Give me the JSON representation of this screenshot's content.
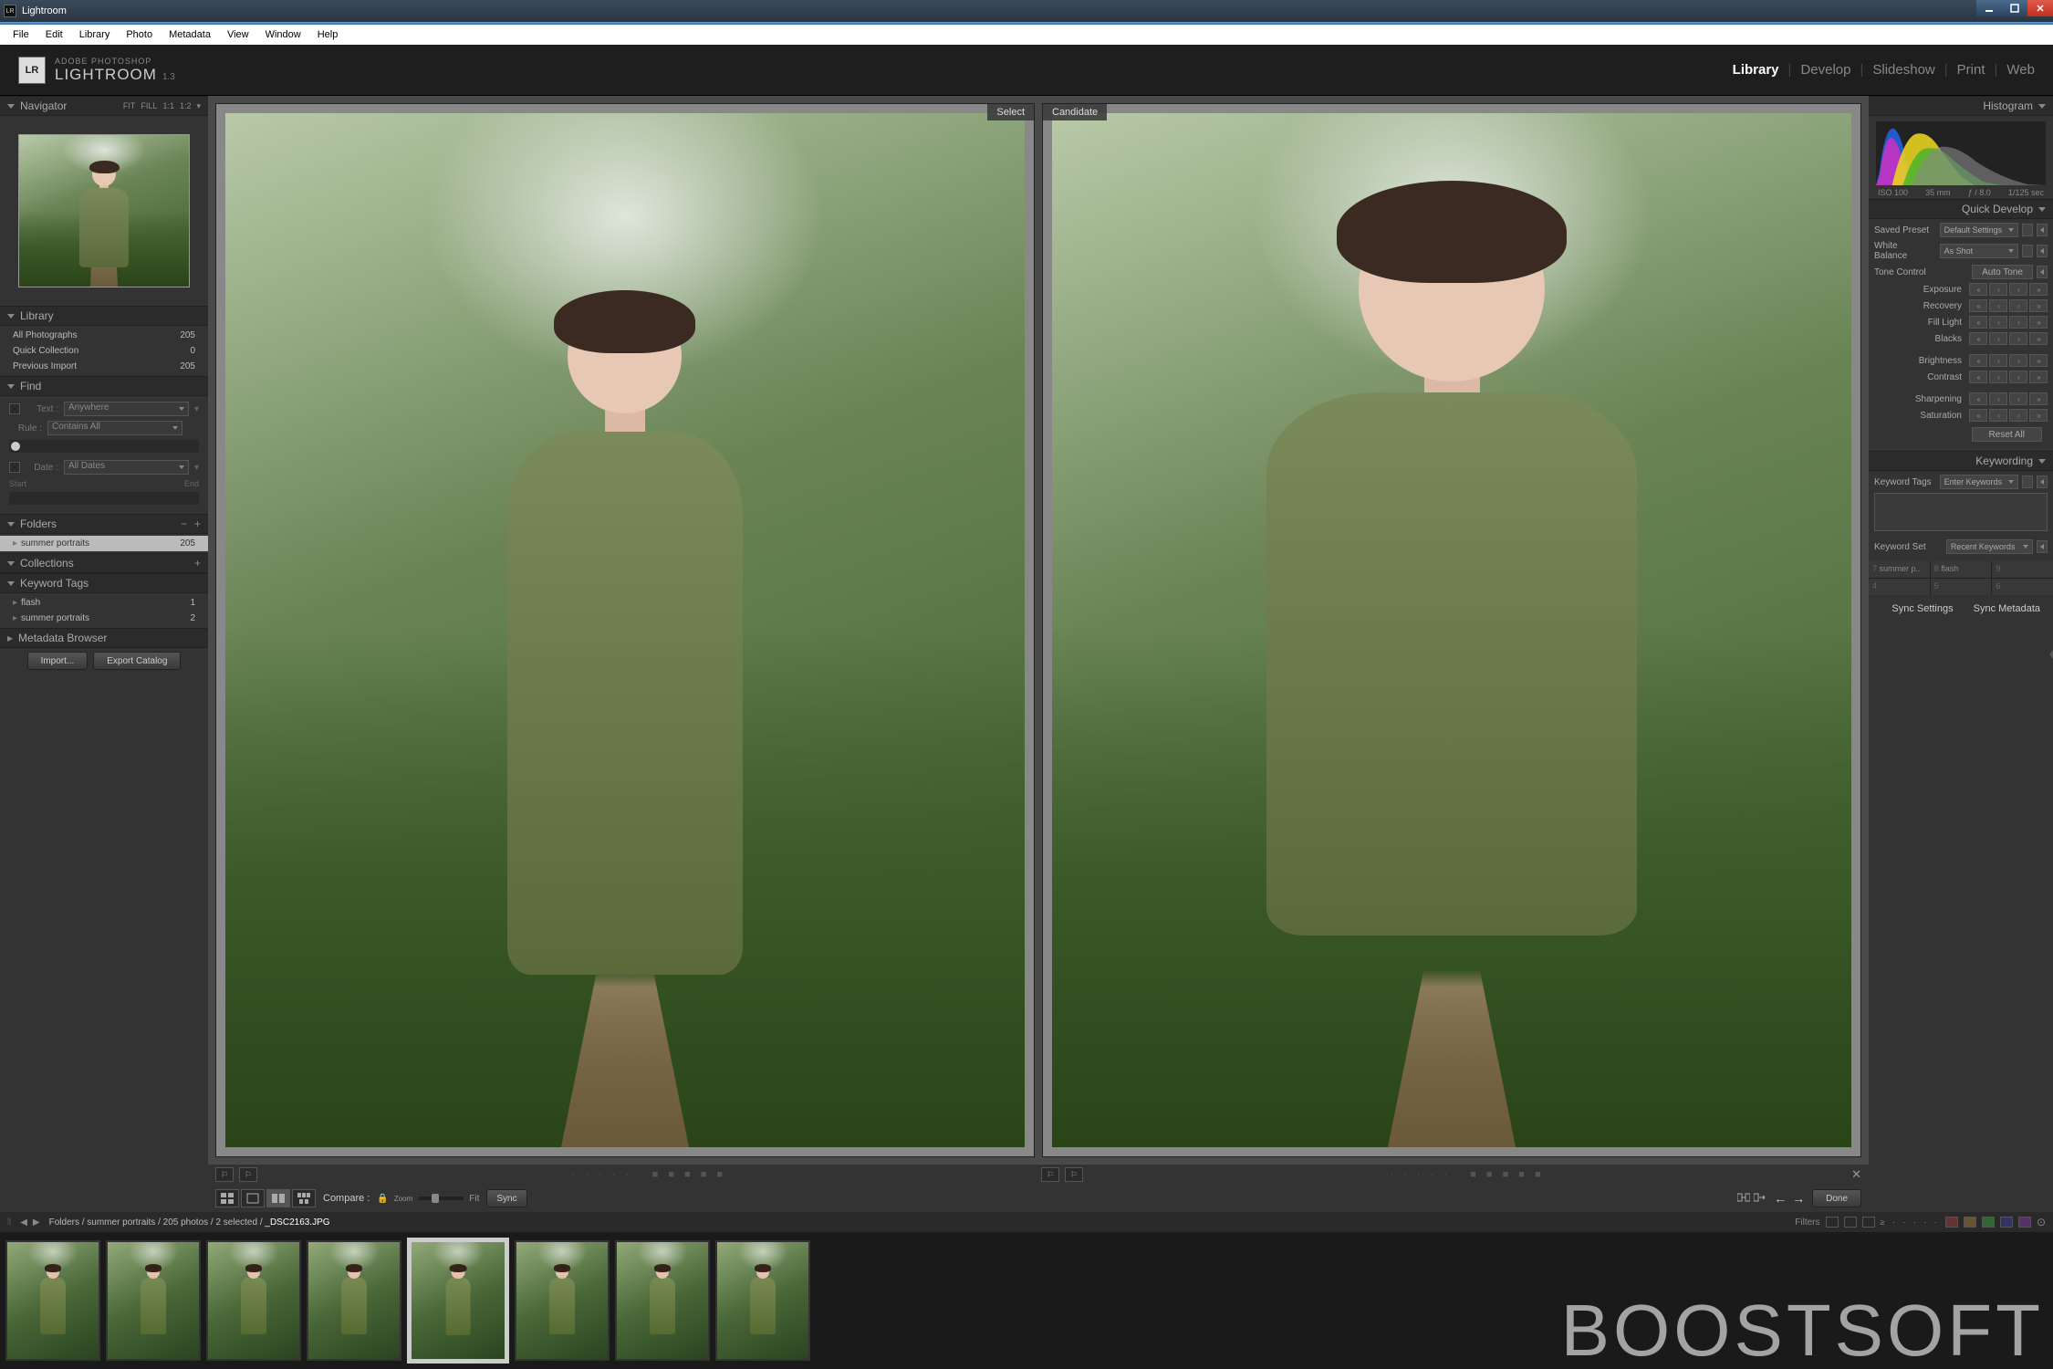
{
  "window": {
    "title": "Lightroom"
  },
  "menubar": [
    "File",
    "Edit",
    "Library",
    "Photo",
    "Metadata",
    "View",
    "Window",
    "Help"
  ],
  "brand": {
    "line1": "ADOBE PHOTOSHOP",
    "line2": "LIGHTROOM",
    "version": "1.3",
    "logo": "LR"
  },
  "modules": [
    {
      "label": "Library",
      "active": true
    },
    {
      "label": "Develop",
      "active": false
    },
    {
      "label": "Slideshow",
      "active": false
    },
    {
      "label": "Print",
      "active": false
    },
    {
      "label": "Web",
      "active": false
    }
  ],
  "navigator": {
    "title": "Navigator",
    "zoom_opts": [
      "FIT",
      "FILL",
      "1:1",
      "1:2"
    ]
  },
  "library": {
    "title": "Library",
    "items": [
      {
        "label": "All Photographs",
        "count": "205"
      },
      {
        "label": "Quick Collection",
        "count": "0"
      },
      {
        "label": "Previous Import",
        "count": "205"
      }
    ]
  },
  "find": {
    "title": "Find",
    "text_label": "Text :",
    "text_value": "Anywhere",
    "rule_label": "Rule :",
    "rule_value": "Contains All",
    "date_label": "Date :",
    "date_value": "All Dates",
    "start": "Start",
    "end": "End"
  },
  "folders": {
    "title": "Folders",
    "items": [
      {
        "label": "summer portraits",
        "count": "205",
        "selected": true
      }
    ]
  },
  "collections": {
    "title": "Collections"
  },
  "keyword_tags": {
    "title": "Keyword Tags",
    "items": [
      {
        "label": "flash",
        "count": "1"
      },
      {
        "label": "summer portraits",
        "count": "2"
      }
    ]
  },
  "metadata_browser": {
    "title": "Metadata Browser"
  },
  "compare": {
    "select_label": "Select",
    "candidate_label": "Candidate"
  },
  "left_toolbar": {
    "import": "Import...",
    "export": "Export Catalog"
  },
  "main_toolbar": {
    "compare_label": "Compare :",
    "zoom": "Zoom",
    "fit": "Fit",
    "sync": "Sync",
    "done": "Done"
  },
  "histogram": {
    "title": "Histogram",
    "iso": "ISO 100",
    "focal": "35 mm",
    "aperture": "ƒ / 8.0",
    "shutter": "1/125 sec"
  },
  "quick_develop": {
    "title": "Quick Develop",
    "saved_preset": "Saved Preset",
    "saved_preset_val": "Default Settings",
    "white_balance": "White Balance",
    "white_balance_val": "As Shot",
    "tone_control": "Tone Control",
    "auto_tone": "Auto Tone",
    "rows": [
      "Exposure",
      "Recovery",
      "Fill Light",
      "Blacks",
      "Brightness",
      "Contrast",
      "Sharpening",
      "Saturation"
    ],
    "reset": "Reset All"
  },
  "keywording": {
    "title": "Keywording",
    "tags_label": "Keyword Tags",
    "tags_value": "Enter Keywords",
    "set_label": "Keyword Set",
    "set_value": "Recent Keywords",
    "grid": [
      [
        "7",
        "summer p..",
        "8",
        "flash",
        "9",
        ""
      ],
      [
        "4",
        "",
        "5",
        "",
        "6",
        ""
      ]
    ]
  },
  "right_toolbar": {
    "sync_settings": "Sync Settings",
    "sync_metadata": "Sync Metadata"
  },
  "breadcrumb": {
    "path": "Folders / summer portraits / 205 photos / 2 selected / ",
    "file": "_DSC2163.JPG",
    "filters": "Filters"
  },
  "watermark": "BOOSTSOFT",
  "filmstrip_count": 8,
  "filmstrip_selected": 4
}
